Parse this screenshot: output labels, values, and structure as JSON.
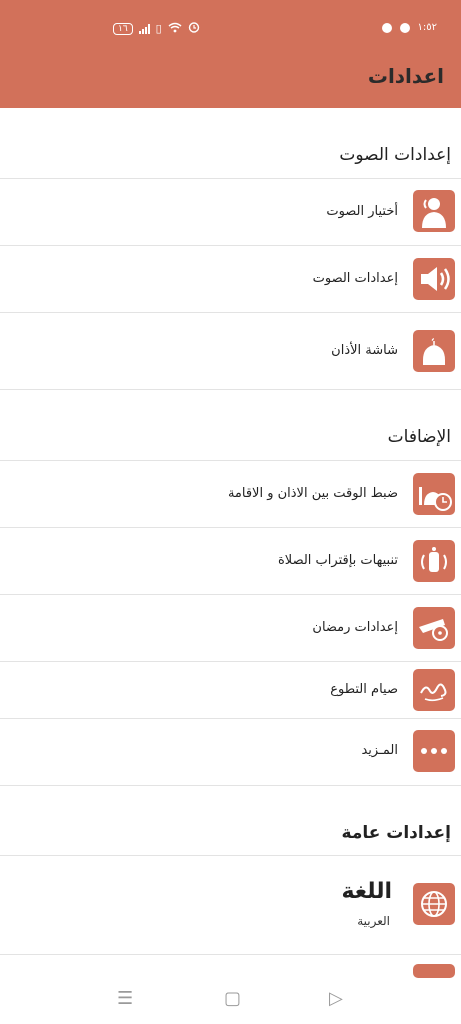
{
  "status": {
    "battery": "١٦",
    "time": "١:٥٢"
  },
  "appbar": {
    "title": "اعدادات"
  },
  "sections": {
    "sound": "إعدادات الصوت",
    "extras": "الإضافات",
    "general": "إعدادات عامة"
  },
  "sound_items": [
    {
      "label": "أختيار الصوت",
      "icon": "muezzin-icon"
    },
    {
      "label": "إعدادات الصوت",
      "icon": "speaker-icon"
    },
    {
      "label": "شاشة الأذان",
      "icon": "mosque-dome-icon"
    }
  ],
  "extra_items": [
    {
      "label": "ضبط الوقت بين الاذان و الاقامة",
      "icon": "mosque-clock-icon"
    },
    {
      "label": "تنبيهات بإقتراب الصلاة",
      "icon": "lantern-alarm-icon"
    },
    {
      "label": "إعدادات رمضان",
      "icon": "cannon-icon"
    },
    {
      "label": "صيام التطوع",
      "icon": "calligraphy-icon"
    },
    {
      "label": "المـزيد",
      "icon": "more-dots-icon"
    }
  ],
  "general_items": [
    {
      "title": "اللغة",
      "subtitle": "العربية",
      "icon": "globe-icon"
    }
  ],
  "colors": {
    "accent": "#D2715A"
  }
}
